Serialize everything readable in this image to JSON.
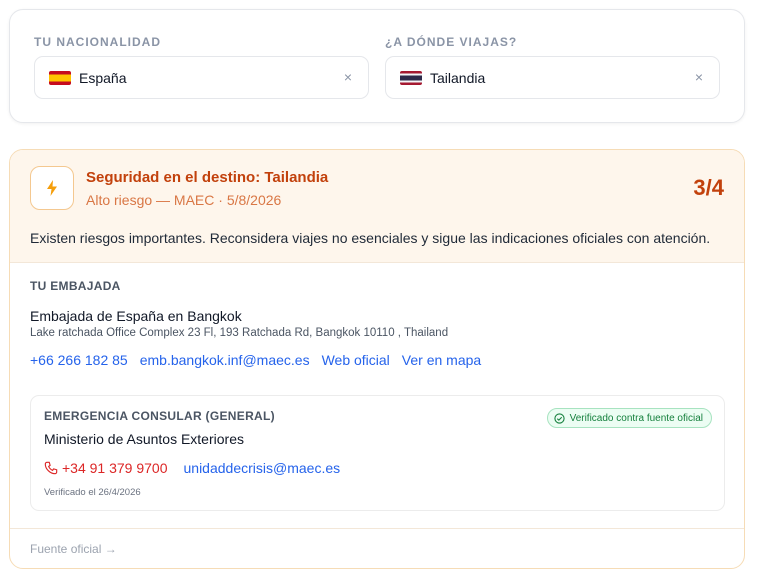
{
  "nationality": {
    "label": "TU NACIONALIDAD",
    "value": "España",
    "flag_icon": "spain-flag-icon",
    "clear_icon": "×"
  },
  "destination": {
    "label": "¿A DÓNDE VIAJAS?",
    "value": "Tailandia",
    "flag_icon": "thailand-flag-icon",
    "clear_icon": "×"
  },
  "safety": {
    "title": "Seguridad en el destino: Tailandia",
    "subtitle": "Alto riesgo — MAEC · 5/8/2026",
    "score": "3/4",
    "advisory": "Existen riesgos importantes. Reconsidera viajes no esenciales y sigue las indicaciones oficiales con atención.",
    "icon": "lightning-bolt-icon"
  },
  "embassy": {
    "section_label": "TU EMBAJADA",
    "name": "Embajada de España en Bangkok",
    "address": "Lake ratchada Office Complex 23 Fl, 193 Ratchada Rd, Bangkok 10110 , Thailand",
    "phone": "+66 266 182 85",
    "email": "emb.bangkok.inf@maec.es",
    "website_label": "Web oficial",
    "map_label": "Ver en mapa"
  },
  "emergency": {
    "section_label": "EMERGENCIA CONSULAR (GENERAL)",
    "badge": "Verificado contra fuente oficial",
    "name": "Ministerio de Asuntos Exteriores",
    "phone": "+34 91 379 9700",
    "email": "unidaddecrisis@maec.es",
    "verified_note": "Verificado el 26/4/2026"
  },
  "source_link": "Fuente oficial →",
  "colors": {
    "accent_orange": "#c2410c",
    "link_blue": "#2563eb",
    "phone_red": "#dc2626",
    "verified_green": "#15803d",
    "card_tint": "#fef6ec"
  }
}
